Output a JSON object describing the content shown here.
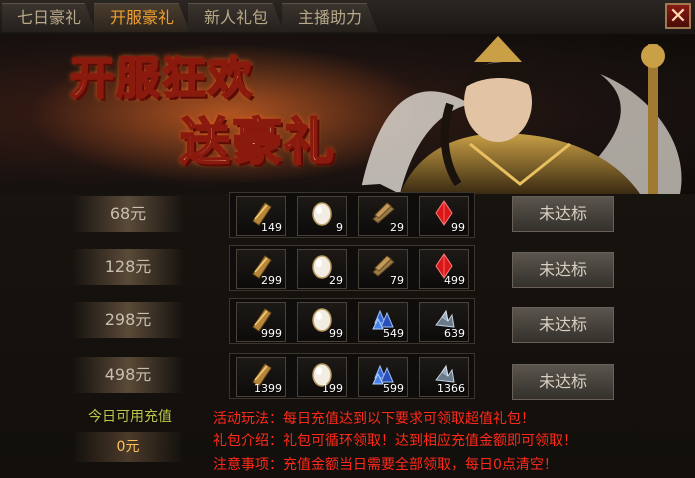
{
  "tabs": [
    {
      "label": "七日豪礼",
      "active": false
    },
    {
      "label": "开服豪礼",
      "active": true
    },
    {
      "label": "新人礼包",
      "active": false
    },
    {
      "label": "主播助力",
      "active": false
    }
  ],
  "close_glyph": "✕",
  "banner": {
    "line1": "开服狂欢",
    "line2": "送豪礼"
  },
  "rows": [
    {
      "price": "68元",
      "button": "未达标",
      "items": [
        {
          "icon": "scroll-icon",
          "qty": "149"
        },
        {
          "icon": "egg-icon",
          "qty": "9"
        },
        {
          "icon": "bundle-icon",
          "qty": "29"
        },
        {
          "icon": "red-crystal-icon",
          "qty": "99"
        }
      ]
    },
    {
      "price": "128元",
      "button": "未达标",
      "items": [
        {
          "icon": "scroll-icon",
          "qty": "299"
        },
        {
          "icon": "egg-icon",
          "qty": "29"
        },
        {
          "icon": "bundle-icon",
          "qty": "79"
        },
        {
          "icon": "red-crystal-icon",
          "qty": "499"
        }
      ]
    },
    {
      "price": "298元",
      "button": "未达标",
      "items": [
        {
          "icon": "scroll-icon",
          "qty": "999"
        },
        {
          "icon": "egg-icon",
          "qty": "99"
        },
        {
          "icon": "blue-crystal-icon",
          "qty": "549"
        },
        {
          "icon": "ore-icon",
          "qty": "639"
        }
      ]
    },
    {
      "price": "498元",
      "button": "未达标",
      "items": [
        {
          "icon": "scroll-icon",
          "qty": "1399"
        },
        {
          "icon": "egg-icon",
          "qty": "199"
        },
        {
          "icon": "blue-crystal-icon",
          "qty": "599"
        },
        {
          "icon": "ore-icon",
          "qty": "1366"
        }
      ]
    }
  ],
  "recharge": {
    "label": "今日可用充值",
    "value": "0元"
  },
  "rules": [
    "活动玩法：每日充值达到以下要求可领取超值礼包！",
    "礼包介绍：礼包可循环领取！达到相应充值金额即可领取！",
    "注意事项：充值金额当日需要全部领取，每日0点清空！"
  ]
}
